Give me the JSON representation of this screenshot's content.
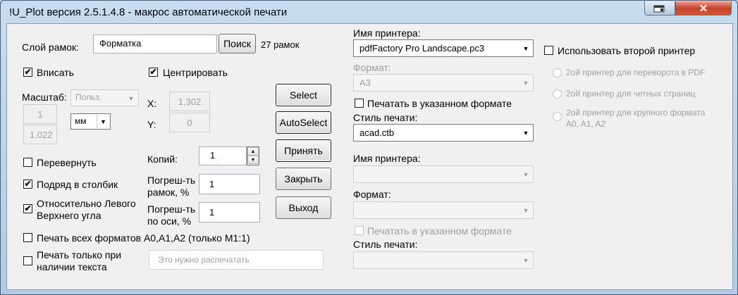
{
  "window": {
    "title": "!U_Plot версия 2.5.1.4.8 - макрос автоматической печати",
    "restore_icon": "restore-icon",
    "close_glyph": "✕"
  },
  "frames": {
    "layer_label": "Слой рамок:",
    "layer_value": "Форматка",
    "search_button": "Поиск",
    "count_text": "27 рамок"
  },
  "options": {
    "fit_label": "Вписать",
    "fit_checked": true,
    "center_label": "Центрировать",
    "center_checked": true,
    "scale_label": "Масштаб:",
    "scale_mode_value": "Польз.",
    "scale_top_value": "1",
    "scale_bottom_value": "1,022",
    "units_value": "мм",
    "x_label": "X:",
    "x_value": "1,302",
    "y_label": "Y:",
    "y_value": "0",
    "flip_label": "Перевернуть",
    "flip_checked": false,
    "column_label": "Подряд в столбик",
    "column_checked": true,
    "topleft_label_line1": "Относительно Левого",
    "topleft_label_line2": "Верхнего угла",
    "topleft_checked": true,
    "copies_label": "Копий:",
    "copies_value": "1",
    "frame_tol_label_line1": "Погреш-ть",
    "frame_tol_label_line2": "рамок, %",
    "frame_tol_value": "1",
    "axis_tol_label_line1": "Погреш-ть",
    "axis_tol_label_line2": "по оси, %",
    "axis_tol_value": "1",
    "all_formats_label": "Печать всех форматов A0,A1,A2 (только М1:1)",
    "all_formats_checked": false,
    "only_text_label_line1": "Печать только при",
    "only_text_label_line2": "наличии текста",
    "only_text_checked": false,
    "only_text_placeholder": "Это нужно распечатать"
  },
  "actions": {
    "select": "Select",
    "autoselect": "AutoSelect",
    "accept": "Принять",
    "close": "Закрыть",
    "exit": "Выход"
  },
  "printer1": {
    "name_label": "Имя принтера:",
    "name_value": "pdfFactory Pro Landscape.pc3",
    "format_label": "Формат:",
    "format_value": "A3",
    "print_in_format_label": "Печатать в указанном формате",
    "print_in_format_checked": false,
    "style_label": "Стиль печати:",
    "style_value": "acad.ctb"
  },
  "printer2": {
    "name_label": "Имя принтера:",
    "name_value": "",
    "format_label": "Формат:",
    "format_value": "",
    "print_in_format_label": "Печатать в указанном формате",
    "style_label": "Стиль печати:",
    "style_value": ""
  },
  "second_printer": {
    "use_label": "Использовать второй принтер",
    "use_checked": false,
    "radio_flip": "2ой принтер для переворота в PDF",
    "radio_even": "2ой принтер для четных страниц",
    "radio_large_line1": "2ой принтер для крупного формата",
    "radio_large_line2": "A0, A1, A2"
  },
  "glyphs": {
    "check": "✔",
    "dropdown": "▼",
    "spin_up": "▲",
    "spin_down": "▼"
  }
}
